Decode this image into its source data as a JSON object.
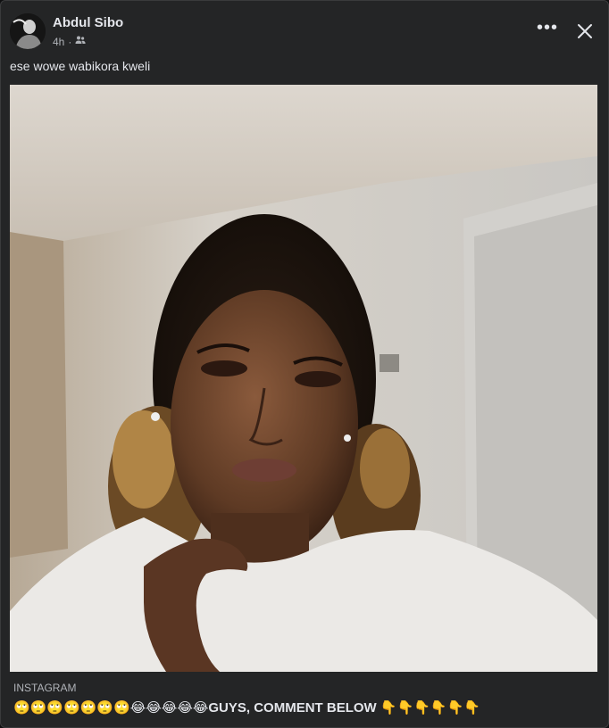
{
  "post": {
    "author": "Abdul Sibo",
    "time": "4h",
    "audience_icon": "friends-icon",
    "caption": "ese wowe wabikora kweli",
    "more_label": "•••",
    "close_icon": "close-icon"
  },
  "link": {
    "source": "INSTAGRAM",
    "emoji_prefix": "🙄🙄🙄🙄🙄🙄🙄😂😂😂😂😂",
    "title": "GUYS, COMMENT BELOW",
    "emoji_suffix": "👇👇👇👇👇👇"
  },
  "colors": {
    "card_bg": "#242526",
    "text_primary": "#e4e6eb",
    "text_secondary": "#b0b3b8"
  }
}
